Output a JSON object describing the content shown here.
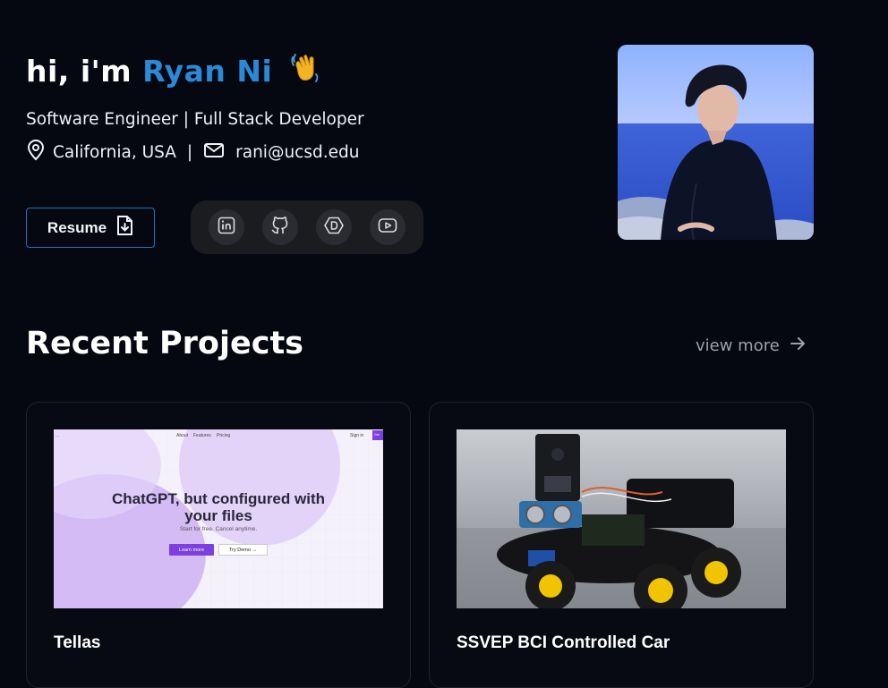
{
  "hero": {
    "greeting_prefix": "hi, i'm",
    "name": "Ryan Ni",
    "subtitle": "Software Engineer | Full Stack Developer",
    "location": "California, USA",
    "separator": "|",
    "email": "rani@ucsd.edu",
    "resume_label": "Resume",
    "socials": [
      {
        "icon": "linkedin-icon"
      },
      {
        "icon": "github-icon"
      },
      {
        "icon": "devpost-icon"
      },
      {
        "icon": "youtube-icon"
      }
    ]
  },
  "projects": {
    "title": "Recent Projects",
    "view_more": "view more",
    "items": [
      {
        "title": "Tellas",
        "thumb": {
          "nav_left": "...",
          "nav_links": [
            "About",
            "Features",
            "Pricing"
          ],
          "nav_signin": "Sign in",
          "nav_cta": "Get",
          "headline_line1": "ChatGPT, but configured with",
          "headline_line2": "your files",
          "sub": "Start for free. Cancel anytime.",
          "primary": "Learn more",
          "secondary": "Try Demo →"
        }
      },
      {
        "title": "SSVEP BCI Controlled Car"
      }
    ]
  },
  "colors": {
    "background": "#050810",
    "accent_name": "#2a8ad8",
    "resume_border": "#1e73b8",
    "social_bar": "#1b1c20"
  }
}
